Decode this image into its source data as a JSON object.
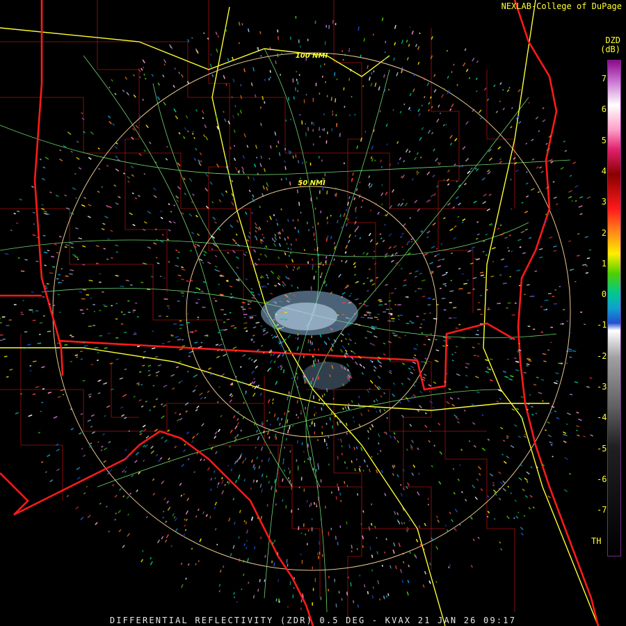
{
  "credit": "NEXLAB-College of DuPage",
  "footer": "DIFFERENTIAL REFLECTIVITY (ZDR) 0.5 DEG - KVAX 21 JAN 26 09:17",
  "legend": {
    "product": "DZD",
    "unit": "(dB)",
    "ticks": [
      "7",
      "6",
      "5",
      "4",
      "3",
      "2",
      "1",
      "0",
      "-1",
      "-2",
      "-3",
      "-4",
      "-5",
      "-6",
      "-7",
      "TH"
    ]
  },
  "range_rings": [
    "100 NMI",
    "50 NMI"
  ],
  "colors": {
    "background": "#000000",
    "state_borders": "#ff1a1a",
    "county_lines": "#b01010",
    "highways": "#ffff33",
    "roads": "#88ee88",
    "range_rings": "#e8c890",
    "label_text": "#ffff33"
  }
}
